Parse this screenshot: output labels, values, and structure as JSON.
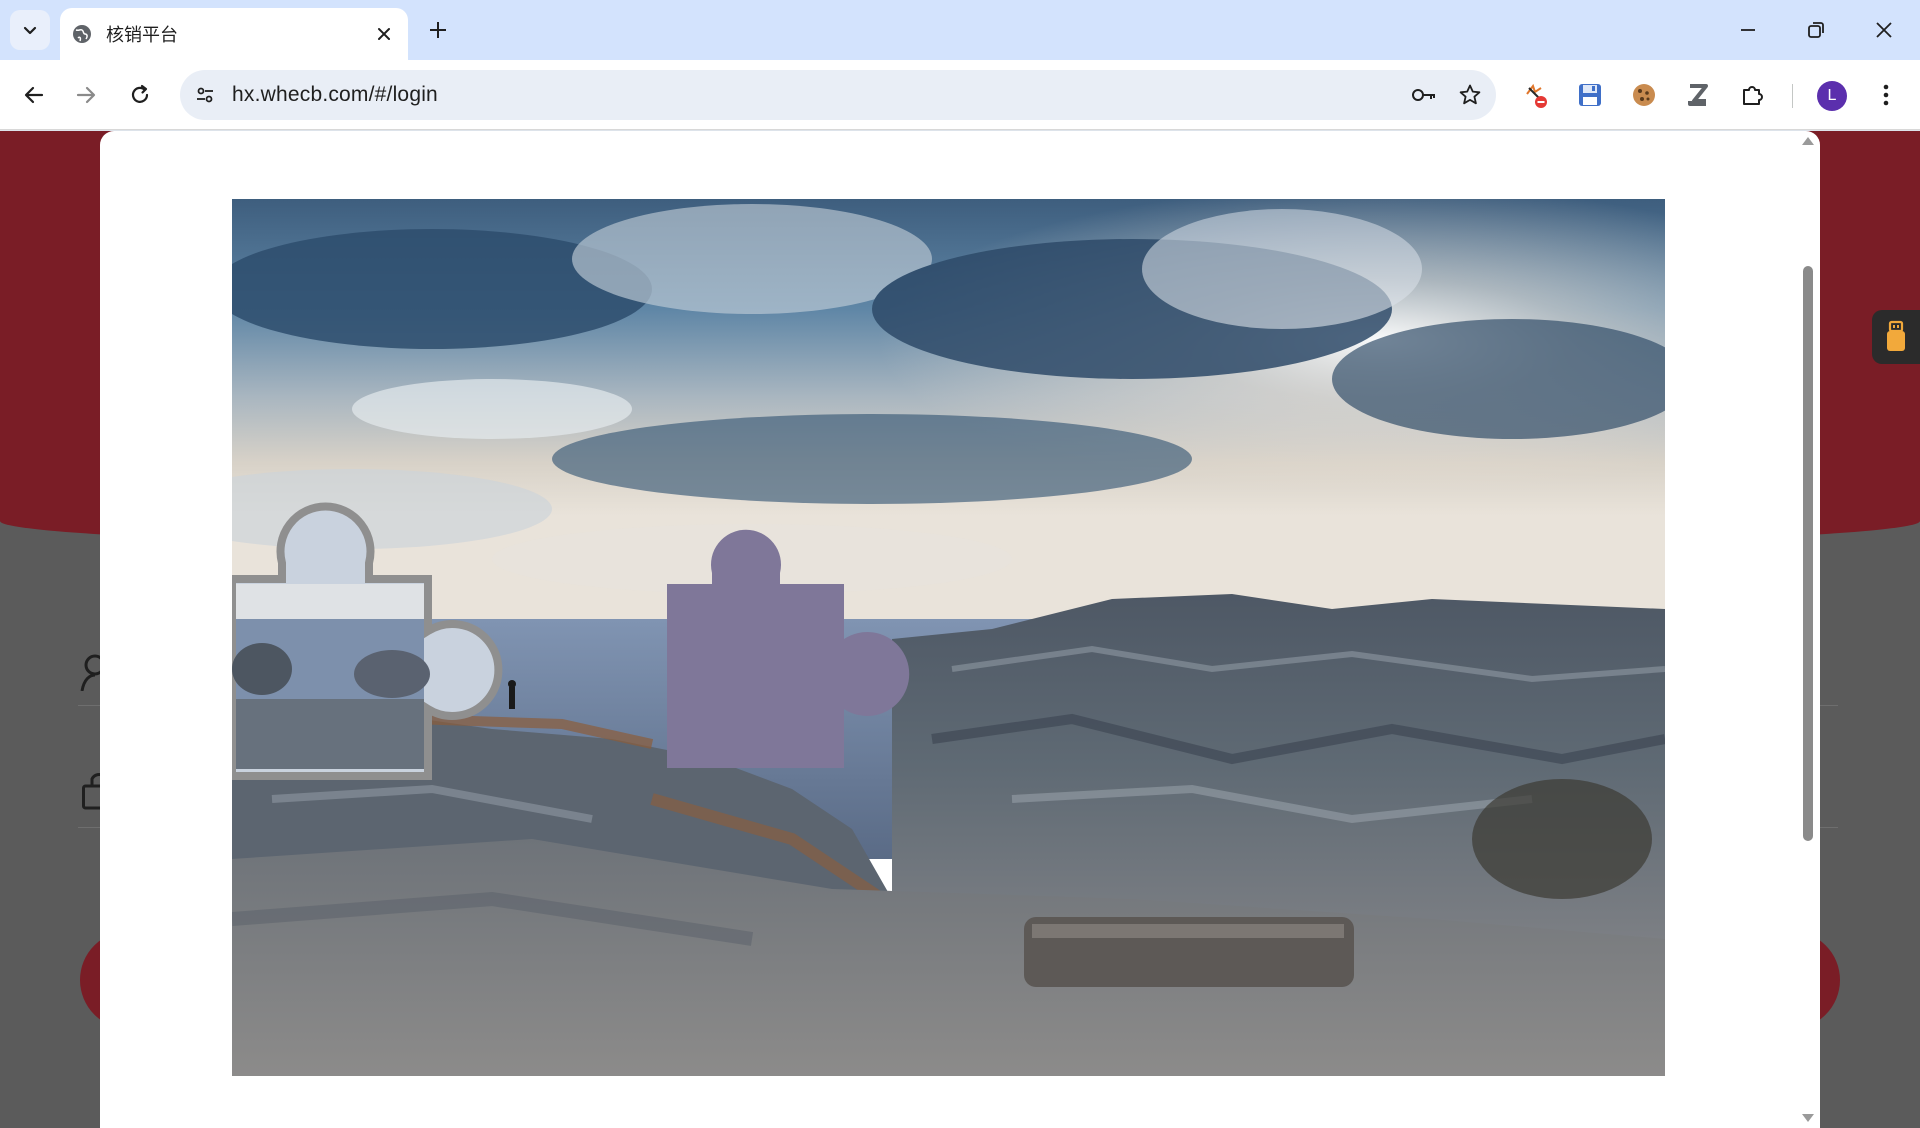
{
  "browser": {
    "tab": {
      "title": "核销平台"
    },
    "url": "hx.whecb.com/#/login",
    "profile_initial": "L"
  },
  "colors": {
    "tabstrip": "#d3e3fd",
    "brand_red": "#7a1d26",
    "puzzle_hole": "#7f7799",
    "avatar": "#5b2fad"
  },
  "icons": [
    "tab-search-icon",
    "globe-icon",
    "close-icon",
    "plus-icon",
    "minimize-icon",
    "restore-icon",
    "window-close-icon",
    "back-arrow-icon",
    "forward-arrow-icon",
    "reload-icon",
    "site-info-icon",
    "key-icon",
    "star-icon",
    "adblock-icon",
    "floppy-disk-icon",
    "cookie-icon",
    "z-extension-icon",
    "puzzle-extension-icon",
    "more-vert-icon",
    "user-icon",
    "lock-icon",
    "usb-icon"
  ],
  "captcha": {
    "type": "slider-puzzle",
    "scene": "rocky coast under cloudy sky"
  }
}
